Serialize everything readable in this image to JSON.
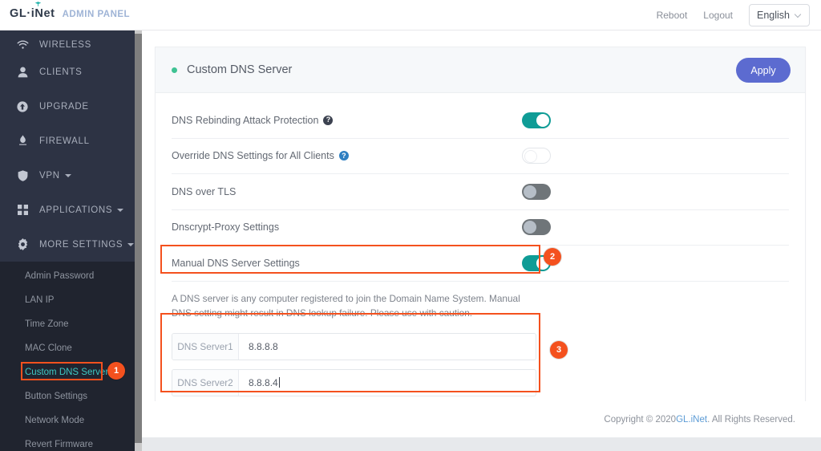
{
  "header": {
    "logo_text": "GL·iNet",
    "logo_icon": "antenna-icon",
    "subtitle": "ADMIN PANEL",
    "reboot_label": "Reboot",
    "logout_label": "Logout",
    "language_value": "English"
  },
  "sidebar": {
    "items": [
      {
        "label": "WIRELESS",
        "icon": "wifi-icon",
        "has_caret": false
      },
      {
        "label": "CLIENTS",
        "icon": "user-icon",
        "has_caret": false
      },
      {
        "label": "UPGRADE",
        "icon": "upload-circle-icon",
        "has_caret": false
      },
      {
        "label": "FIREWALL",
        "icon": "flame-icon",
        "has_caret": false
      },
      {
        "label": "VPN",
        "icon": "shield-icon",
        "has_caret": true
      },
      {
        "label": "APPLICATIONS",
        "icon": "grid-icon",
        "has_caret": true
      },
      {
        "label": "MORE SETTINGS",
        "icon": "gear-icon",
        "has_caret": true
      }
    ],
    "submenu": [
      {
        "label": "Admin Password",
        "active": false
      },
      {
        "label": "LAN IP",
        "active": false
      },
      {
        "label": "Time Zone",
        "active": false
      },
      {
        "label": "MAC Clone",
        "active": false
      },
      {
        "label": "Custom DNS Server",
        "active": true
      },
      {
        "label": "Button Settings",
        "active": false
      },
      {
        "label": "Network Mode",
        "active": false
      },
      {
        "label": "Revert Firmware",
        "active": false
      }
    ]
  },
  "annotations": {
    "badge_1": "1",
    "badge_2": "2",
    "badge_3": "3",
    "highlight_color": "#f4511e"
  },
  "panel": {
    "title": "Custom DNS Server",
    "status_dot_color": "#3fc293",
    "apply_label": "Apply",
    "apply_color": "#5c6bd0",
    "rows": [
      {
        "label": "DNS Rebinding Attack Protection",
        "help": "?",
        "help_style": "dark",
        "toggle": "on"
      },
      {
        "label": "Override DNS Settings for All Clients",
        "help": "?",
        "help_style": "blue",
        "toggle": "off"
      },
      {
        "label": "DNS over TLS",
        "help": "",
        "help_style": "none",
        "toggle": "disabled"
      },
      {
        "label": "Dnscrypt-Proxy Settings",
        "help": "",
        "help_style": "none",
        "toggle": "disabled"
      },
      {
        "label": "Manual DNS Server Settings",
        "help": "",
        "help_style": "none",
        "toggle": "on"
      }
    ],
    "description": "A DNS server is any computer registered to join the Domain Name System. Manual DNS setting might result in DNS lookup failure. Please use with caution.",
    "inputs": [
      {
        "label": "DNS Server1",
        "value": "8.8.8.8",
        "focused": false
      },
      {
        "label": "DNS Server2",
        "value": "8.8.8.4",
        "focused": true
      }
    ]
  },
  "footer": {
    "copyright_prefix": "Copyright © 2020 ",
    "brand_link": "GL.iNet",
    "copyright_suffix": ". All Rights Reserved."
  }
}
